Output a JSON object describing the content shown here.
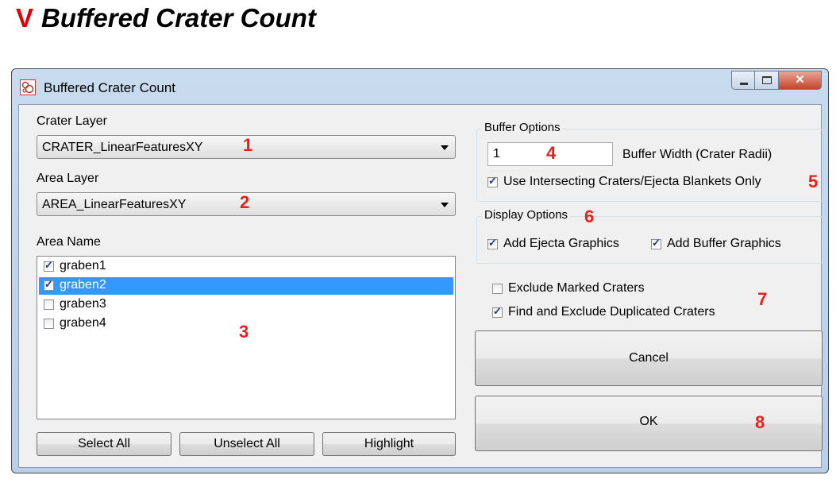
{
  "doc": {
    "marker": "V",
    "title": "Buffered Crater Count"
  },
  "window": {
    "title": "Buffered Crater Count",
    "icon": "app-icon-crater"
  },
  "caption_buttons": {
    "minimize": "minimize-icon",
    "maximize": "maximize-icon",
    "close": "close-icon"
  },
  "crater_layer": {
    "label": "Crater Layer",
    "value": "CRATER_LinearFeaturesXY"
  },
  "area_layer": {
    "label": "Area Layer",
    "value": "AREA_LinearFeaturesXY"
  },
  "area_name": {
    "label": "Area Name",
    "items": [
      {
        "label": "graben1",
        "checked": true,
        "selected": false
      },
      {
        "label": "graben2",
        "checked": true,
        "selected": true
      },
      {
        "label": "graben3",
        "checked": false,
        "selected": false
      },
      {
        "label": "graben4",
        "checked": false,
        "selected": false
      }
    ]
  },
  "list_buttons": {
    "select_all": "Select All",
    "unselect_all": "Unselect All",
    "highlight": "Highlight"
  },
  "buffer_options": {
    "title": "Buffer Options",
    "width_value": "1",
    "width_label": "Buffer Width (Crater Radii)",
    "intersecting_label": "Use Intersecting Craters/Ejecta Blankets Only",
    "intersecting_checked": true
  },
  "display_options": {
    "title": "Display Options",
    "ejecta_label": "Add Ejecta Graphics",
    "ejecta_checked": true,
    "buffer_label": "Add Buffer Graphics",
    "buffer_checked": true
  },
  "exclude": {
    "marked_label": "Exclude Marked Craters",
    "marked_checked": false,
    "duplicated_label": "Find and Exclude Duplicated Craters",
    "duplicated_checked": true
  },
  "actions": {
    "cancel": "Cancel",
    "ok": "OK"
  },
  "annotations": [
    "1",
    "2",
    "3",
    "4",
    "5",
    "6",
    "7",
    "8"
  ],
  "colors": {
    "annotation": "#e8201a",
    "selection": "#3399ff",
    "marker": "#e00000"
  }
}
